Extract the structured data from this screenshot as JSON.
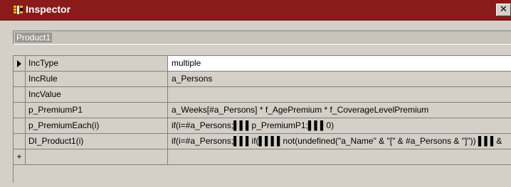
{
  "window": {
    "title": "Inspector",
    "close_label": "✕"
  },
  "object_name": "Product1",
  "grid": {
    "rows": [
      {
        "name": "IncType",
        "value": "multiple",
        "indicator": "current"
      },
      {
        "name": "IncRule",
        "value": "a_Persons"
      },
      {
        "name": "IncValue",
        "value": ""
      },
      {
        "name": "p_PremiumP1",
        "value": "a_Weeks[#a_Persons] * f_AgePremium * f_CoverageLevelPremium"
      },
      {
        "name": "p_PremiumEach(i)",
        "value": "if(i=#a_Persons;▌▌▌p_PremiumP1;▌▌▌0)"
      },
      {
        "name": "DI_Product1(i)",
        "value": "if(i=#a_Persons;▌▌▌if(▌▌▌▌not(undefined(\"a_Name\" & \"[\" & #a_Persons & \"]\")) ▌▌▌&"
      },
      {
        "name": "",
        "value": "",
        "indicator": "+"
      }
    ]
  }
}
